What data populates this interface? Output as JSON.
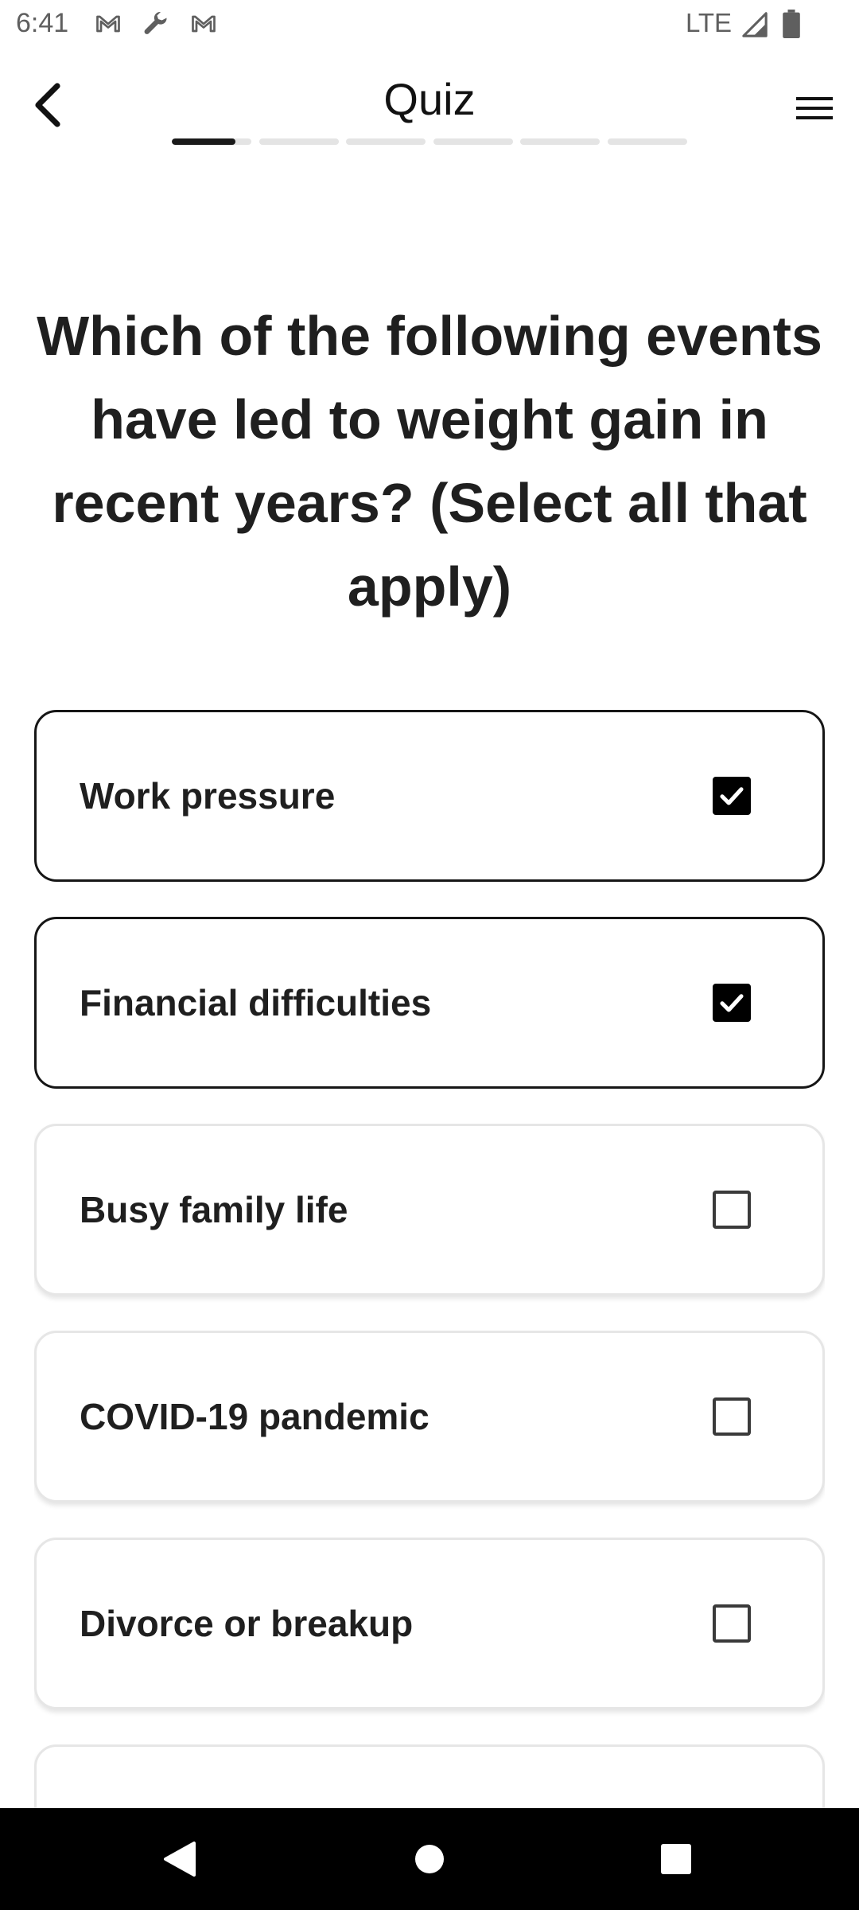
{
  "status_bar": {
    "time": "6:41",
    "network": "LTE",
    "notification_icons": [
      "gmail-icon",
      "wrench-icon",
      "gmail-icon"
    ]
  },
  "header": {
    "title": "Quiz",
    "back_icon": "chevron-left-icon",
    "menu_icon": "hamburger-menu-icon"
  },
  "progress": {
    "segments": 6,
    "first_segment_fill": 0.8
  },
  "question": "Which of the following events have led to weight gain in recent years? (Select all that apply)",
  "options": [
    {
      "label": "Work pressure",
      "checked": true
    },
    {
      "label": "Financial difficulties",
      "checked": true
    },
    {
      "label": "Busy family life",
      "checked": false
    },
    {
      "label": "COVID-19 pandemic",
      "checked": false
    },
    {
      "label": "Divorce or breakup",
      "checked": false
    },
    {
      "label": "",
      "checked": false
    }
  ],
  "colors": {
    "selected_border": "#161616",
    "unselected_border": "#e6e6e6",
    "checkbox_checked": "#000000",
    "progress_active": "#1a1a1a",
    "progress_inactive": "#e4e4e4"
  },
  "nav_bar": {
    "back_icon": "triangle-back-icon",
    "home_icon": "circle-home-icon",
    "recents_icon": "square-recents-icon"
  }
}
